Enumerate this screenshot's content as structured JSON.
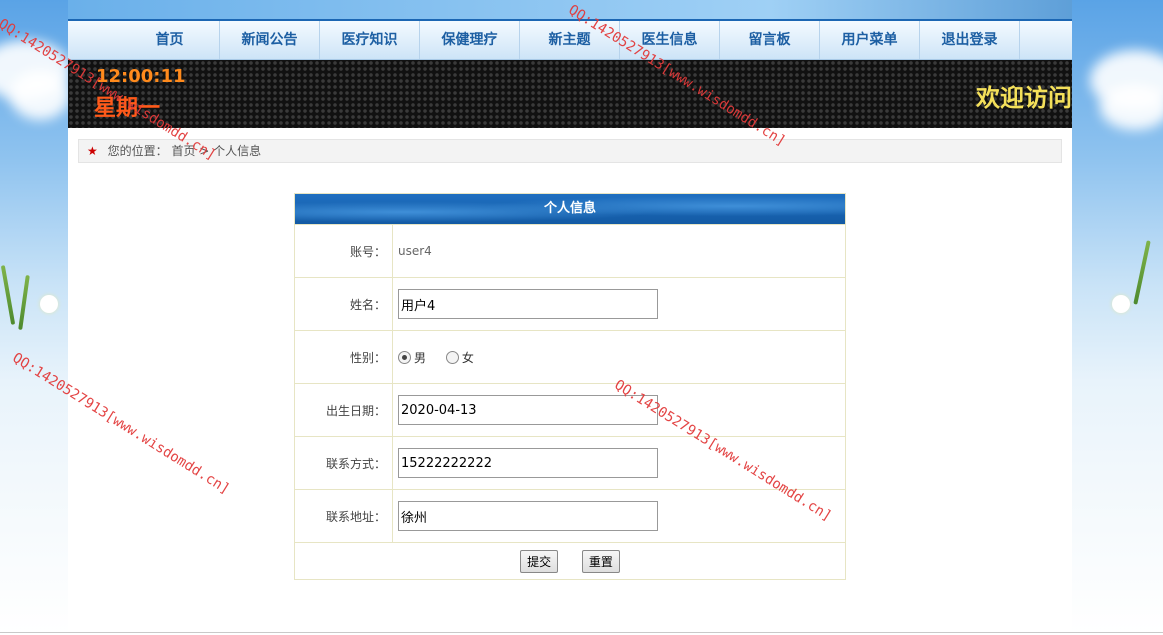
{
  "nav": {
    "items": [
      {
        "label": "首页"
      },
      {
        "label": "新闻公告"
      },
      {
        "label": "医疗知识"
      },
      {
        "label": "保健理疗"
      },
      {
        "label": "新主题"
      },
      {
        "label": "医生信息"
      },
      {
        "label": "留言板"
      },
      {
        "label": "用户菜单"
      },
      {
        "label": "退出登录"
      }
    ]
  },
  "ticker": {
    "time": "12:00:11",
    "weekday": "星期一",
    "marquee": "欢迎访问"
  },
  "breadcrumb": {
    "prefix": "您的位置：",
    "home": "首页",
    "separator": ">",
    "current": "个人信息"
  },
  "form": {
    "title": "个人信息",
    "account_label": "账号：",
    "account_value": "user4",
    "name_label": "姓名：",
    "name_value": "用户4",
    "gender_label": "性别：",
    "gender_options": [
      "男",
      "女"
    ],
    "gender_selected": "男",
    "birth_label": "出生日期：",
    "birth_value": "2020-04-13",
    "phone_label": "联系方式：",
    "phone_value": "15222222222",
    "address_label": "联系地址：",
    "address_value": "徐州",
    "submit_label": "提交",
    "reset_label": "重置"
  },
  "watermark": {
    "text": "QQ:1420527913[www.wisdomdd.cn]"
  },
  "colors": {
    "nav_text": "#1d5fa3",
    "form_header": "#1f6fc0",
    "watermark": "#e23a3a",
    "clock": "#ff8a1c",
    "marquee": "#f4e05a"
  }
}
